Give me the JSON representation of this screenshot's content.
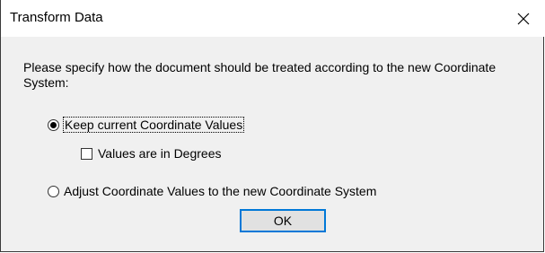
{
  "window": {
    "title": "Transform Data"
  },
  "prompt": "Please specify how the document should be treated according to the new Coordinate System:",
  "options": {
    "keep": {
      "label": "Keep current Coordinate Values",
      "selected": true
    },
    "degrees": {
      "label": "Values are in Degrees",
      "checked": false
    },
    "adjust": {
      "label": "Adjust Coordinate Values to the new Coordinate System",
      "selected": false
    }
  },
  "buttons": {
    "ok": "OK"
  },
  "colors": {
    "accent": "#0078d7",
    "dialog_bg": "#f0f0f0",
    "button_bg": "#e1e1e1"
  }
}
